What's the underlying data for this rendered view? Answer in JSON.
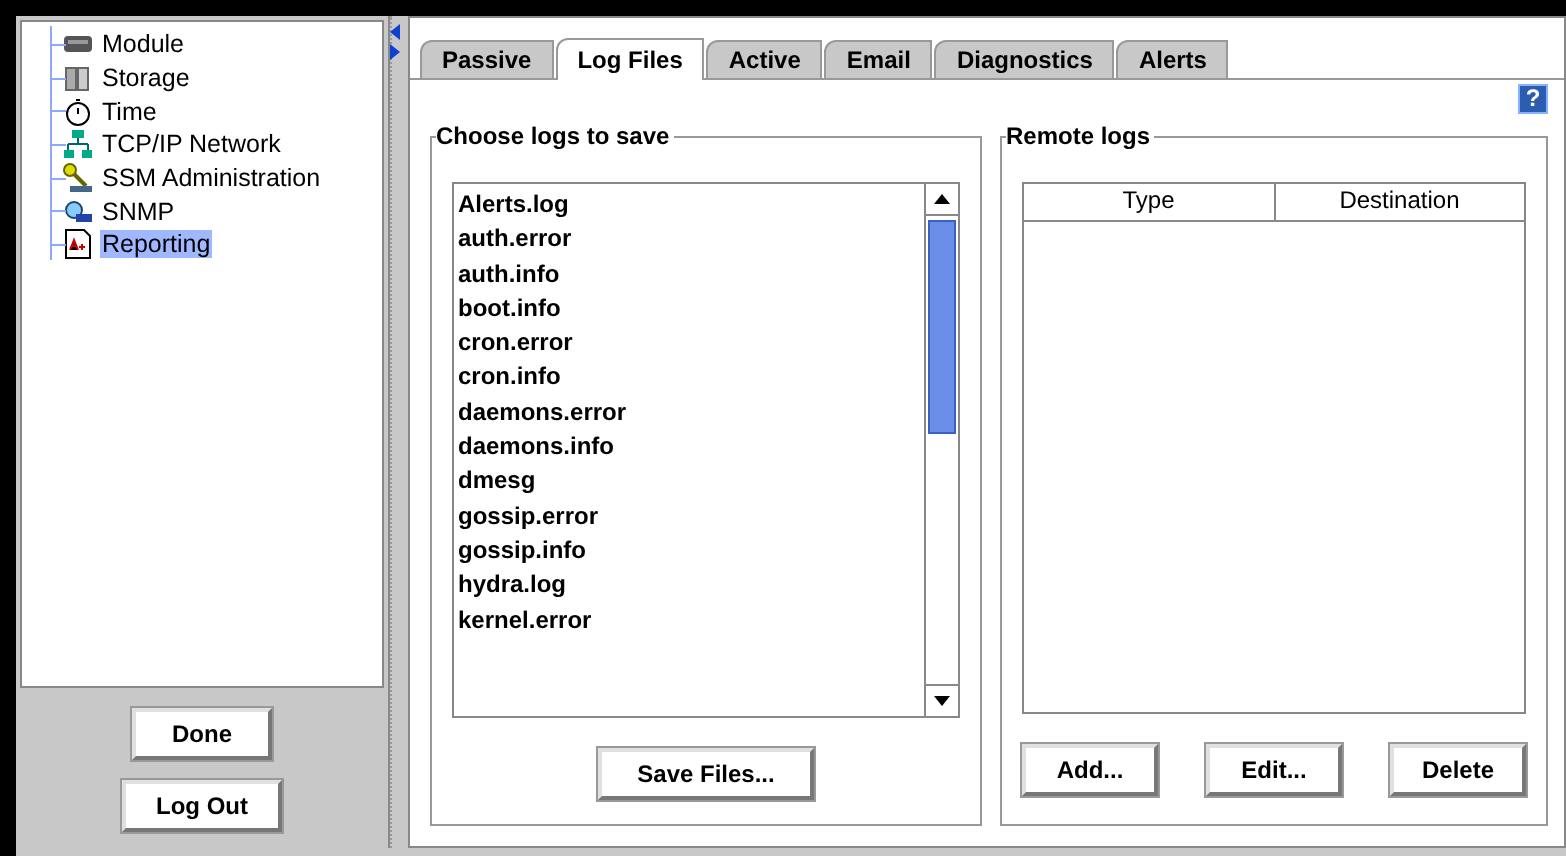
{
  "tree": [
    {
      "label": "Module",
      "kind": "module",
      "selected": false
    },
    {
      "label": "Storage",
      "kind": "storage",
      "selected": false
    },
    {
      "label": "Time",
      "kind": "time",
      "selected": false
    },
    {
      "label": "TCP/IP Network",
      "kind": "network",
      "selected": false
    },
    {
      "label": "SSM Administration",
      "kind": "admin",
      "selected": false
    },
    {
      "label": "SNMP",
      "kind": "snmp",
      "selected": false
    },
    {
      "label": "Reporting",
      "kind": "report",
      "selected": true
    }
  ],
  "side_buttons": [
    "Done",
    "Log Out"
  ],
  "tabs": [
    {
      "label": "Passive",
      "selected": false
    },
    {
      "label": "Log Files",
      "selected": true
    },
    {
      "label": "Active",
      "selected": false
    },
    {
      "label": "Email",
      "selected": false
    },
    {
      "label": "Diagnostics",
      "selected": false
    },
    {
      "label": "Alerts",
      "selected": false
    }
  ],
  "help_button": "?",
  "logs_group": {
    "title": "Choose logs to save",
    "items": [
      "Alerts.log",
      "auth.error",
      "auth.info",
      "boot.info",
      "cron.error",
      "cron.info",
      "daemons.error",
      "daemons.info",
      "dmesg",
      "gossip.error",
      "gossip.info",
      "hydra.log",
      "kernel.error"
    ],
    "button": "Save Files..."
  },
  "remote_group": {
    "title": "Remote logs",
    "columns": [
      "Type",
      "Destination"
    ],
    "buttons": [
      "Add...",
      "Edit...",
      "Delete"
    ]
  }
}
